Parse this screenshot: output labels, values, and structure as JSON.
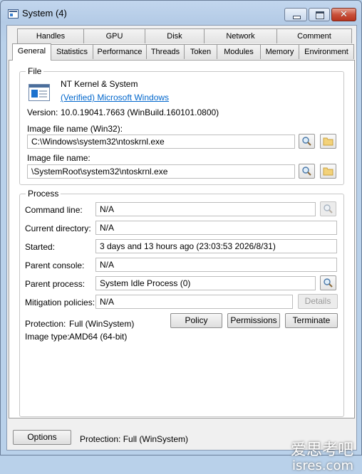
{
  "window": {
    "title": "System (4)"
  },
  "tabs_top": [
    "Handles",
    "GPU",
    "Disk",
    "Network",
    "Comment"
  ],
  "tabs_bottom": [
    "General",
    "Statistics",
    "Performance",
    "Threads",
    "Token",
    "Modules",
    "Memory",
    "Environment"
  ],
  "active_tab": "General",
  "file": {
    "group_title": "File",
    "description": "NT Kernel & System",
    "company": "(Verified) Microsoft Windows",
    "version_label": "Version:",
    "version_value": "10.0.19041.7663 (WinBuild.160101.0800)",
    "win32_label": "Image file name (Win32):",
    "win32_value": "C:\\Windows\\system32\\ntoskrnl.exe",
    "native_label": "Image file name:",
    "native_value": "\\SystemRoot\\system32\\ntoskrnl.exe"
  },
  "process": {
    "group_title": "Process",
    "command_line_label": "Command line:",
    "command_line_value": "N/A",
    "current_dir_label": "Current directory:",
    "current_dir_value": "N/A",
    "started_label": "Started:",
    "started_value": "3 days and 13 hours ago (23:03:53 2026/8/31)",
    "parent_console_label": "Parent console:",
    "parent_console_value": "N/A",
    "parent_process_label": "Parent process:",
    "parent_process_value": "System Idle Process (0)",
    "mitigation_label": "Mitigation policies:",
    "mitigation_value": "N/A",
    "details_button": "Details",
    "protection_label": "Protection:",
    "protection_value": "Full (WinSystem)",
    "image_type_label": "Image type:",
    "image_type_value": "AMD64 (64-bit)",
    "policy_button": "Policy",
    "permissions_button": "Permissions",
    "terminate_button": "Terminate"
  },
  "footer": {
    "options_button": "Options",
    "status": "Protection: Full (WinSystem)"
  },
  "watermark": {
    "line1": "爱思考吧",
    "line2": "isres.com"
  },
  "colors": {
    "link": "#0066cc",
    "close_button": "#c9503a",
    "frame": "#b9d1ea"
  },
  "icons": [
    "app-icon",
    "minimize-icon",
    "maximize-icon",
    "close-icon",
    "search-icon",
    "folder-icon",
    "executable-icon"
  ]
}
